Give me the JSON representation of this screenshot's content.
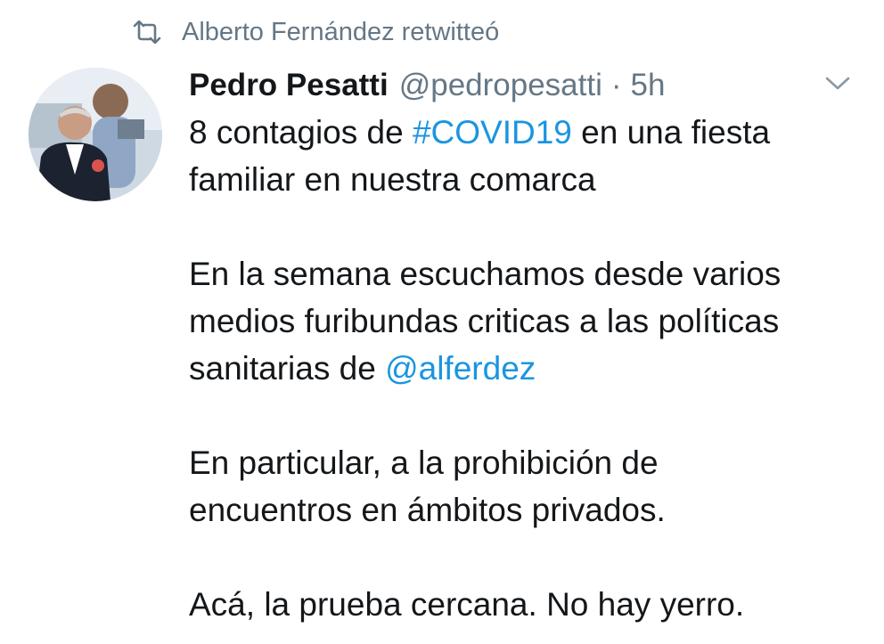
{
  "retweet": {
    "icon": "retweet-icon",
    "text": "Alberto Fernández retwitteó"
  },
  "tweet": {
    "author_name": "Pedro Pesatti",
    "handle": "@pedropesatti",
    "separator": "·",
    "time": "5h",
    "menu_icon": "chevron-down-icon",
    "lines": {
      "l1_pre": "8 contagios de ",
      "l1_hashtag": "#COVID19",
      "l1_post": " en una fiesta",
      "l2": "familiar en nuestra comarca",
      "l3": "En la semana escuchamos desde varios",
      "l4": "medios furibundas criticas a las políticas",
      "l5_pre": "sanitarias de ",
      "l5_mention": "@alferdez",
      "l6": "En particular, a la prohibición de",
      "l7": "encuentros en ámbitos privados.",
      "l8": "Acá, la prueba cercana. No hay yerro."
    }
  },
  "colors": {
    "text": "#14171a",
    "secondary": "#657786",
    "link": "#1b95e0",
    "background": "#ffffff"
  }
}
